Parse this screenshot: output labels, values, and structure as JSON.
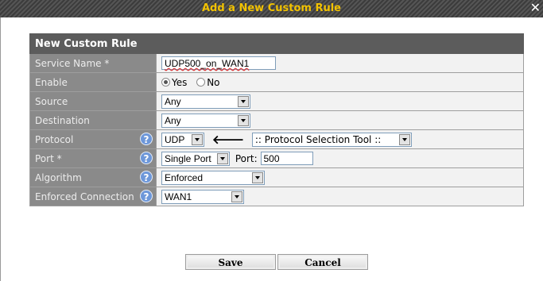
{
  "dialog": {
    "title": "Add a New Custom Rule",
    "close_glyph": "✕"
  },
  "panel": {
    "heading": "New Custom Rule"
  },
  "rows": {
    "service_name": {
      "label": "Service Name *",
      "value": "UDP500_on_WAN1"
    },
    "enable": {
      "label": "Enable",
      "options": [
        "Yes",
        "No"
      ],
      "selected": "Yes"
    },
    "source": {
      "label": "Source",
      "value": "Any"
    },
    "destination": {
      "label": "Destination",
      "value": "Any"
    },
    "protocol": {
      "label": "Protocol",
      "value": "UDP",
      "arrow": "🡐",
      "tool_value": ":: Protocol Selection Tool ::"
    },
    "port": {
      "label": "Port *",
      "mode": "Single Port",
      "port_label": "Port:",
      "port_value": "500"
    },
    "algorithm": {
      "label": "Algorithm",
      "value": "Enforced"
    },
    "enforced_connection": {
      "label": "Enforced Connection",
      "value": "WAN1"
    }
  },
  "help_glyph": "?",
  "buttons": {
    "save": "Save",
    "cancel": "Cancel"
  },
  "icons": [
    "close-icon",
    "help-icon",
    "radio-icon",
    "left-arrow-icon",
    "dropdown-arrow-icon"
  ]
}
